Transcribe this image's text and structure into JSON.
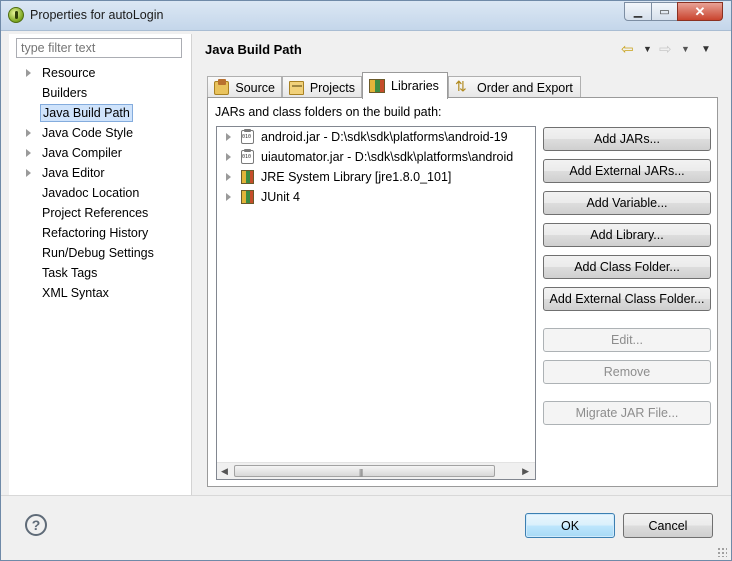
{
  "window": {
    "title": "Properties for autoLogin",
    "minimize_icon": "minimize-icon",
    "maximize_icon": "maximize-icon",
    "close_icon": "close-icon"
  },
  "sidebar": {
    "filter_placeholder": "type filter text",
    "items": [
      {
        "label": "Resource",
        "expandable": true,
        "selected": false
      },
      {
        "label": "Builders",
        "expandable": false,
        "selected": false
      },
      {
        "label": "Java Build Path",
        "expandable": false,
        "selected": true
      },
      {
        "label": "Java Code Style",
        "expandable": true,
        "selected": false
      },
      {
        "label": "Java Compiler",
        "expandable": true,
        "selected": false
      },
      {
        "label": "Java Editor",
        "expandable": true,
        "selected": false
      },
      {
        "label": "Javadoc Location",
        "expandable": false,
        "selected": false
      },
      {
        "label": "Project References",
        "expandable": false,
        "selected": false
      },
      {
        "label": "Refactoring History",
        "expandable": false,
        "selected": false
      },
      {
        "label": "Run/Debug Settings",
        "expandable": true,
        "selected": false
      },
      {
        "label": "Task Tags",
        "expandable": false,
        "selected": false
      },
      {
        "label": "XML Syntax",
        "expandable": false,
        "selected": false
      }
    ]
  },
  "main": {
    "title": "Java Build Path",
    "tabs": [
      {
        "label": "Source",
        "icon": "source-folder-icon",
        "active": false
      },
      {
        "label": "Projects",
        "icon": "projects-icon",
        "active": false
      },
      {
        "label": "Libraries",
        "icon": "libraries-icon",
        "active": true
      },
      {
        "label": "Order and Export",
        "icon": "order-export-icon",
        "active": false
      }
    ],
    "caption": "JARs and class folders on the build path:",
    "entries": [
      {
        "label": "android.jar - D:\\sdk\\sdk\\platforms\\android-19",
        "icon": "jar-icon"
      },
      {
        "label": "uiautomator.jar - D:\\sdk\\sdk\\platforms\\android",
        "icon": "jar-icon"
      },
      {
        "label": "JRE System Library [jre1.8.0_101]",
        "icon": "library-icon"
      },
      {
        "label": "JUnit 4",
        "icon": "library-icon"
      }
    ],
    "buttons": [
      {
        "label": "Add JARs...",
        "enabled": true
      },
      {
        "label": "Add External JARs...",
        "enabled": true
      },
      {
        "label": "Add Variable...",
        "enabled": true
      },
      {
        "label": "Add Library...",
        "enabled": true
      },
      {
        "label": "Add Class Folder...",
        "enabled": true
      },
      {
        "label": "Add External Class Folder...",
        "enabled": true
      },
      {
        "label": "Edit...",
        "enabled": false
      },
      {
        "label": "Remove",
        "enabled": false
      },
      {
        "label": "Migrate JAR File...",
        "enabled": false
      }
    ]
  },
  "footer": {
    "help_symbol": "?",
    "ok_label": "OK",
    "cancel_label": "Cancel"
  },
  "colors": {
    "selection_bg": "#cfe3fb",
    "selection_border": "#84acdd",
    "default_button_border": "#3c7fb1"
  }
}
